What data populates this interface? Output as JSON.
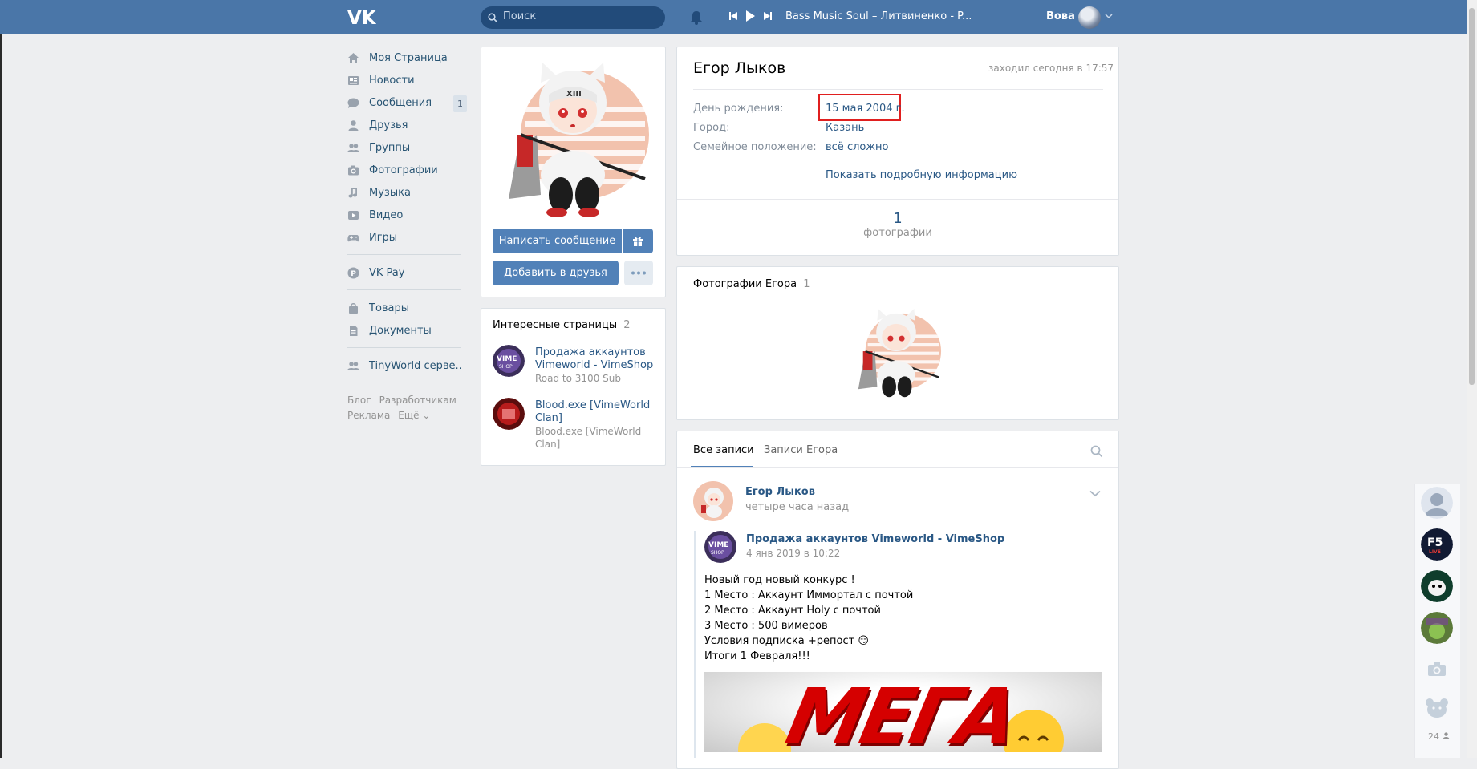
{
  "header": {
    "search_placeholder": "Поиск",
    "track": "Bass Music Soul – Литвиненко - P...",
    "user_name": "Вова"
  },
  "nav": {
    "items": [
      {
        "label": "Моя Страница",
        "icon": "home-icon"
      },
      {
        "label": "Новости",
        "icon": "news-icon"
      },
      {
        "label": "Сообщения",
        "icon": "messages-icon",
        "badge": "1"
      },
      {
        "label": "Друзья",
        "icon": "friend-icon"
      },
      {
        "label": "Группы",
        "icon": "groups-icon"
      },
      {
        "label": "Фотографии",
        "icon": "camera-icon"
      },
      {
        "label": "Музыка",
        "icon": "music-icon"
      },
      {
        "label": "Видео",
        "icon": "video-icon"
      },
      {
        "label": "Игры",
        "icon": "gamepad-icon"
      }
    ],
    "pay": {
      "label": "VK Pay",
      "icon": "vkpay-icon"
    },
    "items2": [
      {
        "label": "Товары",
        "icon": "bag-icon"
      },
      {
        "label": "Документы",
        "icon": "document-icon"
      }
    ],
    "community": {
      "label": "TinyWorld серве..",
      "icon": "groups-icon"
    },
    "footer": [
      "Блог",
      "Разработчикам",
      "Реклама",
      "Ещё ⌄"
    ]
  },
  "profile": {
    "write_message": "Написать сообщение",
    "add_friend": "Добавить в друзья"
  },
  "interesting": {
    "title": "Интересные страницы",
    "count": "2",
    "items": [
      {
        "name": "Продажа аккаунтов Vimeworld - VimeShop",
        "sub": "Road to 3100 Sub"
      },
      {
        "name": "Blood.exe [VimeWorld Clan]",
        "sub": "Blood.exe [VimeWorld Clan]"
      }
    ]
  },
  "info": {
    "name": "Егор Лыков",
    "last_seen": "заходил сегодня в 17:57",
    "birthday_label": "День рождения:",
    "birthday_value": "15 мая 2004 г.",
    "city_label": "Город:",
    "city_value": "Казань",
    "family_label": "Семейное положение:",
    "family_value": "всё сложно",
    "show_more": "Показать подробную информацию",
    "counter_num": "1",
    "counter_label": "фотографии"
  },
  "photos": {
    "title": "Фотографии Егора",
    "count": "1"
  },
  "wall": {
    "tab_all": "Все записи",
    "tab_own": "Записи Егора",
    "author": "Егор Лыков",
    "time": "четыре часа назад",
    "repost_author": "Продажа аккаунтов Vimeworld - VimeShop",
    "repost_time": "4 янв 2019 в 10:22",
    "text_lines": [
      "Новый год новый конкурс !",
      "1 Место : Аккаунт Иммортал с почтой",
      "2 Место : Аккаунт Holy с почтой",
      "3 Место : 500 вимеров",
      "Условия подписка +репост 😏",
      "Итоги 1 Февраля!!!"
    ],
    "banner_text": "МЕГА"
  },
  "right_strip": {
    "online_count": "24"
  },
  "colors": {
    "header": "#4a76a8",
    "link": "#2a5885",
    "button": "#5181b8",
    "background": "#edeef0",
    "highlight": "#e01f1f"
  }
}
